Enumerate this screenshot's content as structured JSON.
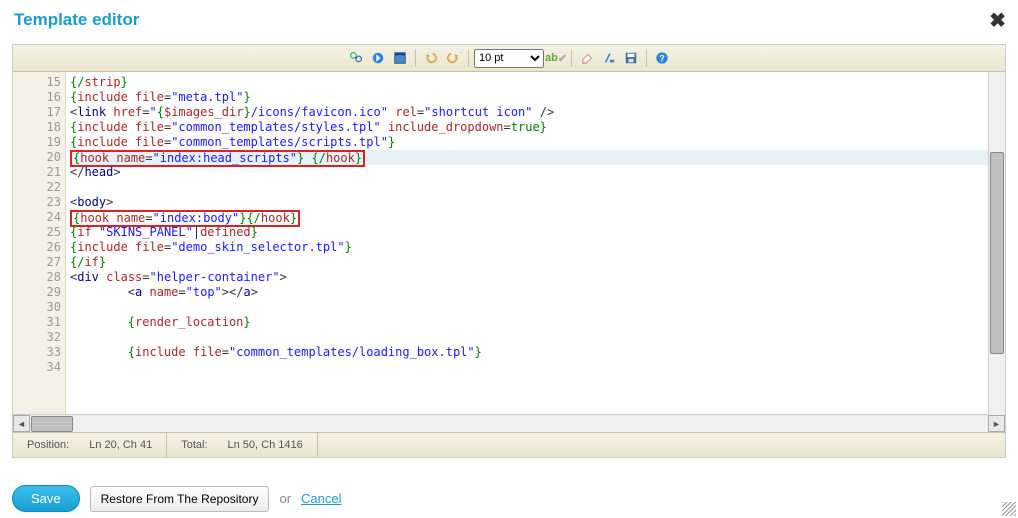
{
  "dialog": {
    "title": "Template editor"
  },
  "toolbar": {
    "font_size_selected": "10 pt",
    "icons": {
      "find": "find-icon",
      "go": "go-icon",
      "fullscreen": "fullscreen-icon",
      "undo": "undo-icon",
      "redo": "redo-icon",
      "highlight": "highlight-icon",
      "eraser": "eraser-icon",
      "format": "format-icon",
      "save": "save-tool-icon",
      "help": "help-icon"
    }
  },
  "gutter": {
    "start": 15,
    "end": 34
  },
  "code": {
    "lines": [
      {
        "n": 15,
        "html": "<span class='tok-op'>{/</span><span class='tok-key'>strip</span><span class='tok-op'>}</span>"
      },
      {
        "n": 16,
        "html": "<span class='tok-op'>{</span><span class='tok-key'>include</span> <span class='tok-attr'>file</span>=<span class='tok-str'>\"meta.tpl\"</span><span class='tok-op'>}</span>"
      },
      {
        "n": 17,
        "html": "&lt;<span class='tok-tag'>link</span> <span class='tok-attr'>href</span>=<span class='tok-str'>\"</span><span class='tok-op'>{</span><span class='tok-key'>$images_dir</span><span class='tok-op'>}</span><span class='tok-str'>/icons/favicon.ico\"</span> <span class='tok-attr'>rel</span>=<span class='tok-str'>\"shortcut icon\"</span> /&gt;"
      },
      {
        "n": 18,
        "html": "<span class='tok-op'>{</span><span class='tok-key'>include</span> <span class='tok-attr'>file</span>=<span class='tok-str'>\"common_templates/styles.tpl\"</span> <span class='tok-attr'>include_dropdown</span>=<span class='tok-kw'>true</span><span class='tok-op'>}</span>"
      },
      {
        "n": 19,
        "html": "<span class='tok-op'>{</span><span class='tok-key'>include</span> <span class='tok-attr'>file</span>=<span class='tok-str'>\"common_templates/scripts.tpl\"</span><span class='tok-op'>}</span>"
      },
      {
        "n": 20,
        "highlight": true,
        "box": true,
        "html": "<span class='tok-op'>{</span><span class='tok-key'>hook</span> <span class='tok-attr'>name</span>=<span class='tok-str'>\"index:head_scripts\"</span><span class='tok-op'>}</span> <span class='tok-op'>{/</span><span class='tok-key'>hook</span><span class='tok-op'>}</span>"
      },
      {
        "n": 21,
        "html": "&lt;/<span class='tok-tag'>head</span>&gt;"
      },
      {
        "n": 22,
        "html": ""
      },
      {
        "n": 23,
        "html": "&lt;<span class='tok-tag'>body</span>&gt;"
      },
      {
        "n": 24,
        "box": true,
        "html": "<span class='tok-op'>{</span><span class='tok-key'>hook</span> <span class='tok-attr'>name</span>=<span class='tok-str'>\"index:body\"</span><span class='tok-op'>}{/</span><span class='tok-key'>hook</span><span class='tok-op'>}</span>"
      },
      {
        "n": 25,
        "html": "<span class='tok-op'>{</span><span class='tok-key'>if</span> <span class='tok-str'>\"SKINS_PANEL\"</span>|<span class='tok-key'>defined</span><span class='tok-op'>}</span>"
      },
      {
        "n": 26,
        "html": "<span class='tok-op'>{</span><span class='tok-key'>include</span> <span class='tok-attr'>file</span>=<span class='tok-str'>\"demo_skin_selector.tpl\"</span><span class='tok-op'>}</span>"
      },
      {
        "n": 27,
        "html": "<span class='tok-op'>{/</span><span class='tok-key'>if</span><span class='tok-op'>}</span>"
      },
      {
        "n": 28,
        "html": "&lt;<span class='tok-tag'>div</span> <span class='tok-attr'>class</span>=<span class='tok-str'>\"helper-container\"</span>&gt;"
      },
      {
        "n": 29,
        "html": "        &lt;<span class='tok-tag'>a</span> <span class='tok-attr'>name</span>=<span class='tok-str'>\"top\"</span>&gt;&lt;/<span class='tok-tag'>a</span>&gt;"
      },
      {
        "n": 30,
        "html": ""
      },
      {
        "n": 31,
        "html": "        <span class='tok-op'>{</span><span class='tok-key'>render_location</span><span class='tok-op'>}</span>"
      },
      {
        "n": 32,
        "html": ""
      },
      {
        "n": 33,
        "html": "        <span class='tok-op'>{</span><span class='tok-key'>include</span> <span class='tok-attr'>file</span>=<span class='tok-str'>\"common_templates/loading_box.tpl\"</span><span class='tok-op'>}</span>"
      },
      {
        "n": 34,
        "html": ""
      }
    ]
  },
  "status": {
    "position_label": "Position:",
    "position_value": "Ln 20, Ch 41",
    "total_label": "Total:",
    "total_value": "Ln 50, Ch 1416"
  },
  "footer": {
    "save": "Save",
    "restore": "Restore From The Repository",
    "or": "or",
    "cancel": "Cancel"
  }
}
